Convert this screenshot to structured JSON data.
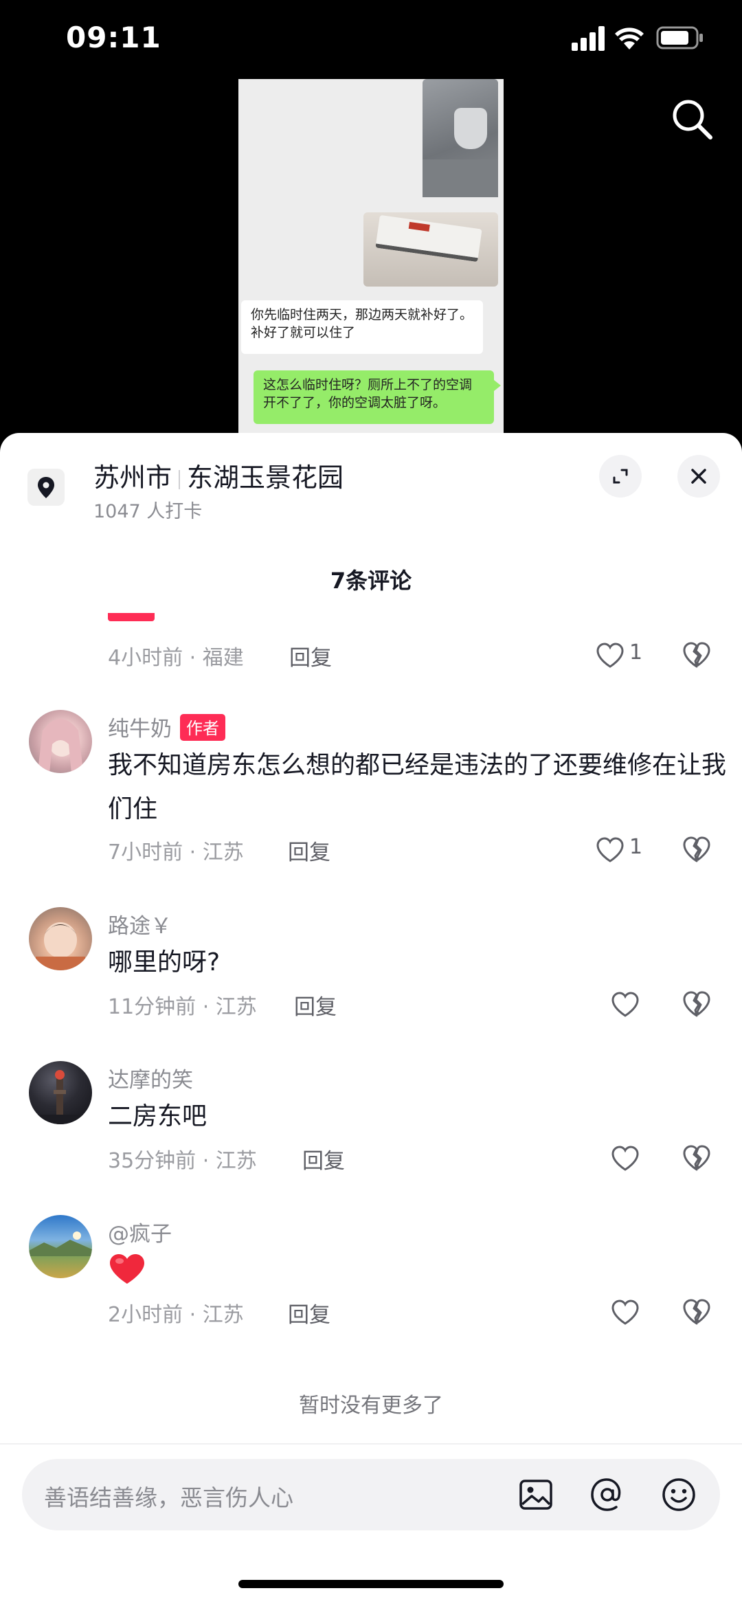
{
  "status": {
    "time": "09:11"
  },
  "video": {
    "bubble_left": "你先临时住两天，那边两天就补好了。补好了就可以住了",
    "bubble_right": "这怎么临时住呀？厕所上不了的空调开不了了，你的空调太脏了呀。"
  },
  "location": {
    "city": "苏州市",
    "place": "东湖玉景花园",
    "checkins": "1047 人打卡"
  },
  "comments_header": "7条评论",
  "partial_comment": {
    "meta": "4小时前 · 福建",
    "reply": "回复",
    "likes": "1"
  },
  "comments": [
    {
      "user": "纯牛奶",
      "badge": "作者",
      "text": "我不知道房东怎么想的都已经是违法的了还要维修在让我们住",
      "meta": "7小时前 · 江苏",
      "reply": "回复",
      "likes": "1"
    },
    {
      "user": "路途￥",
      "text": "哪里的呀?",
      "meta": "11分钟前 · 江苏",
      "reply": "回复"
    },
    {
      "user": "达摩的笑",
      "text": "二房东吧",
      "meta": "35分钟前 · 江苏",
      "reply": "回复"
    },
    {
      "user": "@疯子",
      "text": "",
      "meta": "2小时前 · 江苏",
      "reply": "回复"
    }
  ],
  "no_more": "暂时没有更多了",
  "input": {
    "placeholder": "善语结善缘，恶言伤人心"
  },
  "icons": [
    "search-icon",
    "location-pin-icon",
    "expand-icon",
    "close-icon",
    "heart-icon",
    "broken-heart-icon",
    "image-icon",
    "at-icon",
    "emoji-icon"
  ],
  "colors": {
    "accent": "#fe2c55",
    "wechat_green": "#95ec69"
  }
}
